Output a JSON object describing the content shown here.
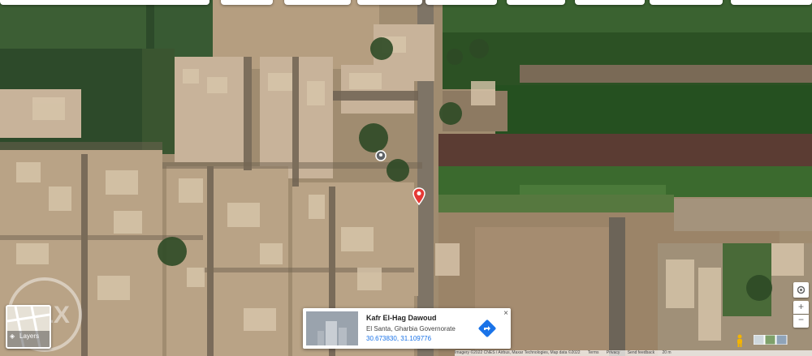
{
  "place_card": {
    "title": "Kafr El-Hag Dawoud",
    "region": "El Santa, Gharbia Governorate",
    "coordinates": "30.673830, 31.109776",
    "close_symbol": "×"
  },
  "layers_control": {
    "label": "Layers",
    "icon": "layers-icon"
  },
  "watermark": {
    "text": "OLX"
  },
  "zoom": {
    "in_symbol": "+",
    "out_symbol": "−"
  },
  "attribution": {
    "imagery": "Imagery ©2022 CNES / Airbus, Maxar Technologies, Map data ©2022",
    "terms": "Terms",
    "privacy": "Privacy",
    "feedback": "Send feedback",
    "scale": "20 m"
  },
  "colors": {
    "pin_red": "#e53935",
    "direction_blue": "#1a73e8",
    "field_green": "#2f5b2a",
    "sand": "#a89478"
  }
}
